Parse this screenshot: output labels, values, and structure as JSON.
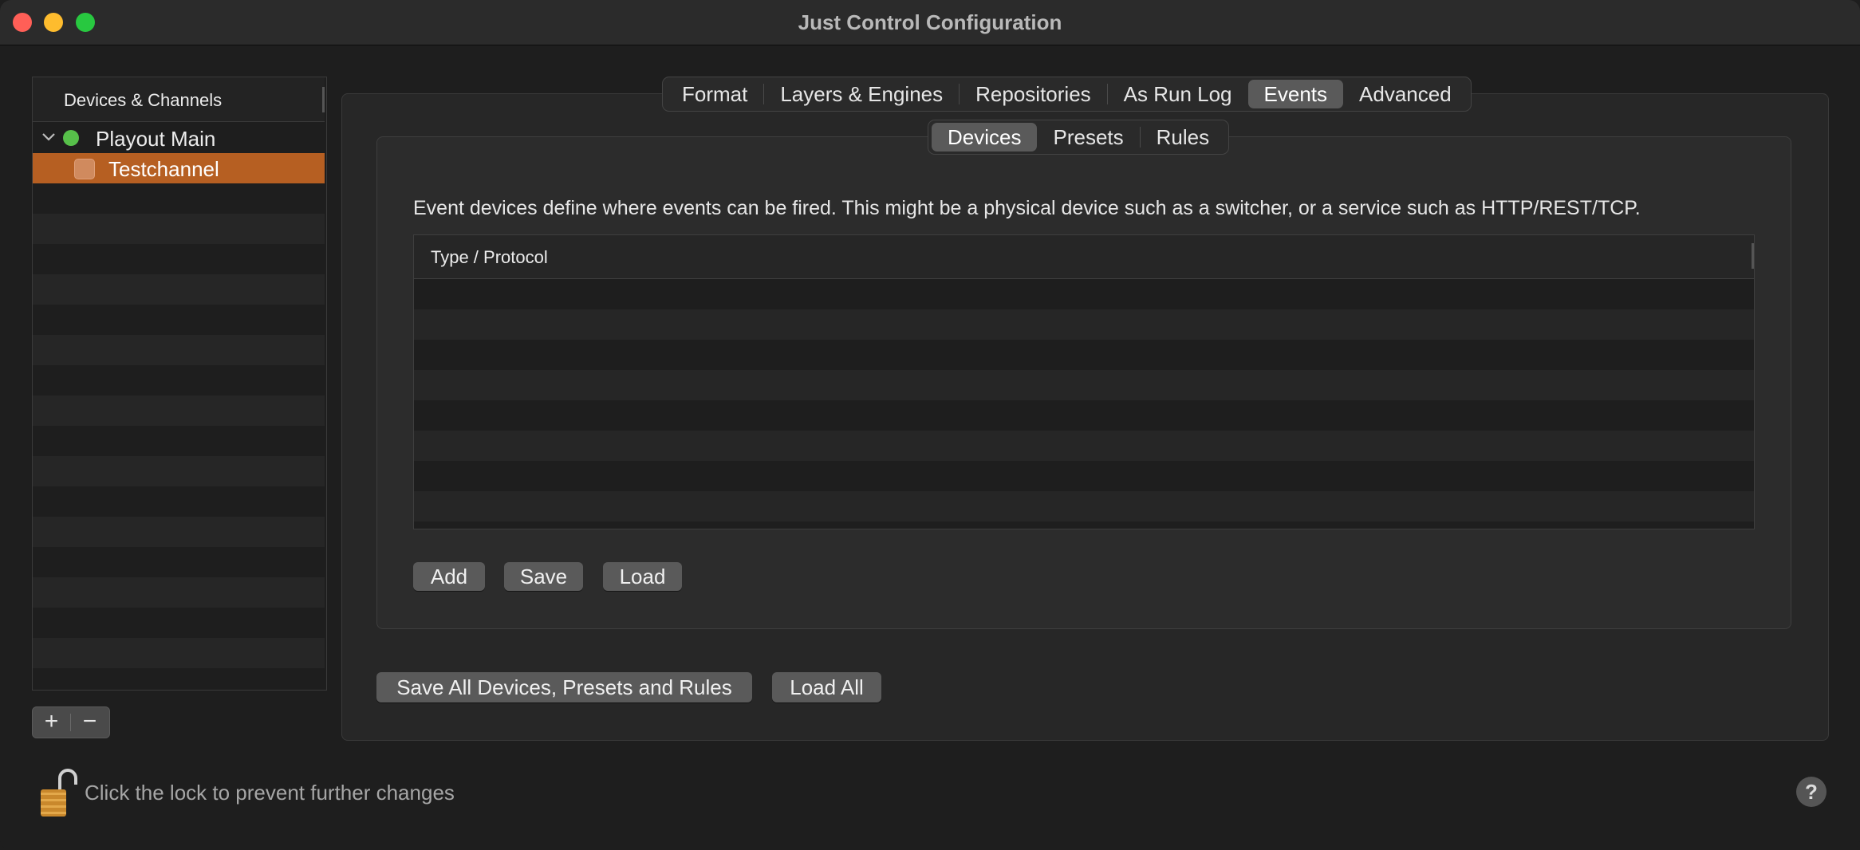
{
  "window": {
    "title": "Just Control Configuration"
  },
  "sidebar": {
    "header": "Devices & Channels",
    "items": [
      {
        "label": "Playout Main",
        "status_color": "#57c04a",
        "expanded": true
      },
      {
        "label": "Testchannel",
        "selected": true
      }
    ],
    "add_label": "+",
    "remove_label": "−"
  },
  "tabs": [
    "Format",
    "Layers & Engines",
    "Repositories",
    "As Run Log",
    "Events",
    "Advanced"
  ],
  "active_tab": "Events",
  "subtabs": [
    "Devices",
    "Presets",
    "Rules"
  ],
  "active_subtab": "Devices",
  "events": {
    "description": "Event devices define where events can be fired. This might be a physical device such as a switcher, or a service such as HTTP/REST/TCP.",
    "table": {
      "columns": [
        "Type / Protocol"
      ],
      "rows": []
    },
    "buttons": {
      "add": "Add",
      "save": "Save",
      "load": "Load"
    }
  },
  "footer_buttons": {
    "save_all": "Save All Devices, Presets and Rules",
    "load_all": "Load All"
  },
  "lock": {
    "text": "Click the lock to prevent further changes"
  },
  "help": {
    "label": "?"
  },
  "colors": {
    "accent_selection": "#b65f22",
    "status_green": "#57c04a"
  }
}
